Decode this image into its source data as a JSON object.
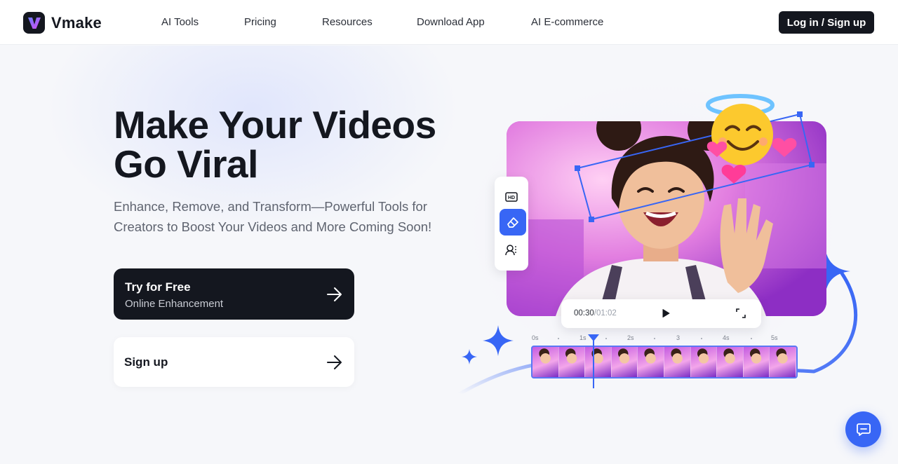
{
  "header": {
    "brand": "Vmake",
    "nav": [
      "AI Tools",
      "Pricing",
      "Resources",
      "Download App",
      "AI E-commerce"
    ],
    "login_label": "Log in / Sign up"
  },
  "hero": {
    "title_line1": "Make Your Videos",
    "title_line2": "Go Viral",
    "subtitle": "Enhance, Remove, and Transform—Powerful Tools for Creators to Boost Your Videos and More Coming Soon!",
    "try_button": {
      "title": "Try for Free",
      "subtitle": "Online Enhancement"
    },
    "signup_button": {
      "title": "Sign up"
    }
  },
  "editor": {
    "tools": [
      {
        "name": "hd-icon",
        "active": false
      },
      {
        "name": "eraser-icon",
        "active": true
      },
      {
        "name": "person-cutout-icon",
        "active": false
      }
    ],
    "player": {
      "current": "00:30",
      "total": "/01:02"
    },
    "ruler_ticks": [
      "0s",
      "1s",
      "2s",
      "3",
      "4s",
      "5s"
    ],
    "frame_count": 10
  },
  "colors": {
    "brand_dark": "#14171f",
    "accent_blue": "#3866f5",
    "text_muted": "#5f6470"
  },
  "icons": {
    "logo": "v-logo-icon",
    "arrow": "arrow-right-icon",
    "play": "play-icon",
    "fullscreen": "fullscreen-icon",
    "chat": "chat-icon"
  }
}
